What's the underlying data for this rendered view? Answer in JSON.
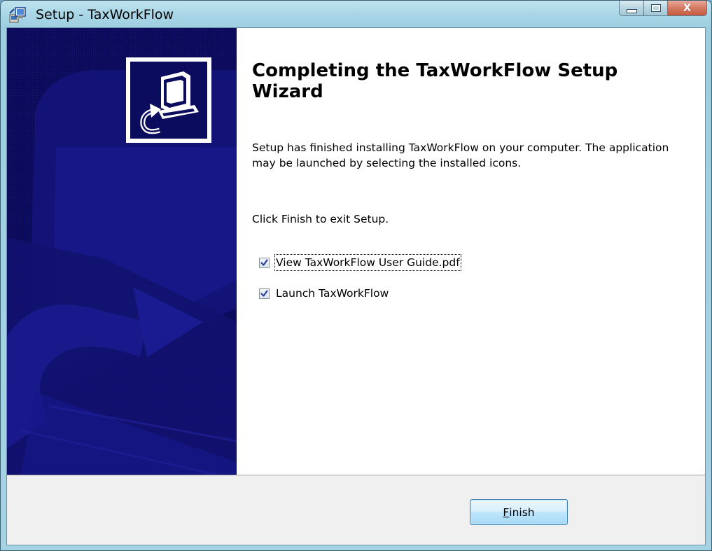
{
  "window": {
    "title": "Setup - TaxWorkFlow",
    "close_glyph": "X"
  },
  "icons": {
    "app": "setup-installer-icon",
    "logo": "computer-install-icon",
    "check": "checkmark-icon"
  },
  "colors": {
    "side_panel": "#0b0b5a",
    "side_art": "#15157e",
    "checkmark": "#2c3f99",
    "button_border": "#3c7fb1"
  },
  "content": {
    "heading": "Completing the TaxWorkFlow Setup Wizard",
    "paragraph_1": "Setup has finished installing TaxWorkFlow on your computer. The application may be launched by selecting the installed icons.",
    "paragraph_2": "Click Finish to exit Setup."
  },
  "options": [
    {
      "label": "View TaxWorkFlow User Guide.pdf",
      "checked": true,
      "focused": true
    },
    {
      "label": "Launch TaxWorkFlow",
      "checked": true,
      "focused": false
    }
  ],
  "footer": {
    "finish_mnemonic": "F",
    "finish_rest": "inish"
  }
}
